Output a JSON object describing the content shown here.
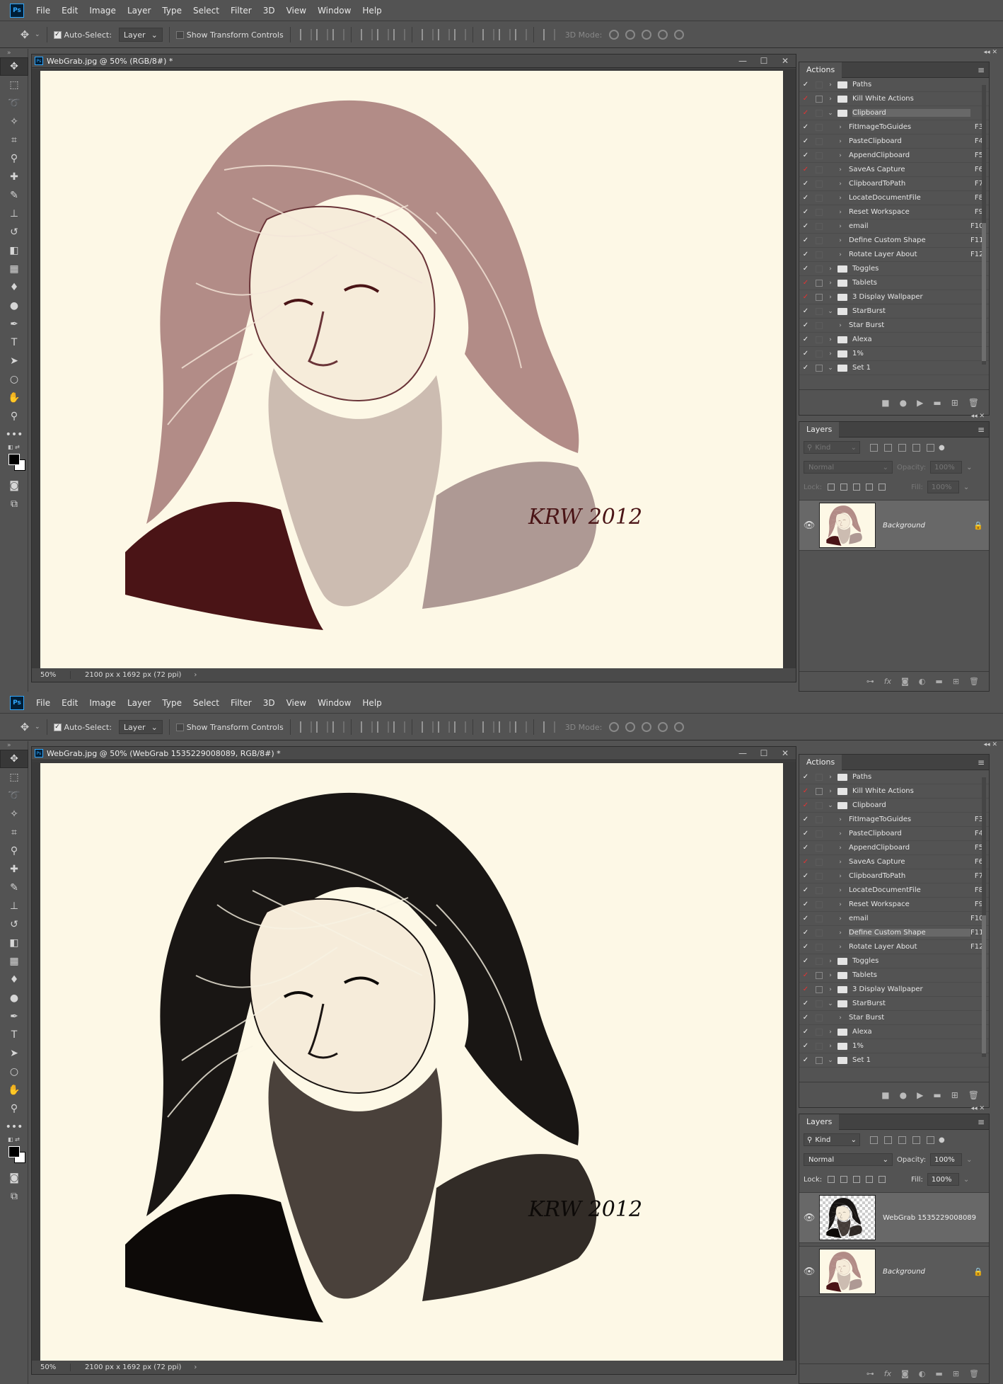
{
  "app": {
    "logo": "Ps"
  },
  "menu": [
    "File",
    "Edit",
    "Image",
    "Layer",
    "Type",
    "Select",
    "Filter",
    "3D",
    "View",
    "Window",
    "Help"
  ],
  "options": {
    "auto_select": "Auto-Select:",
    "auto_select_target": "Layer",
    "show_transform": "Show Transform Controls",
    "mode_3d": "3D Mode:"
  },
  "panels": {
    "actions_tab": "Actions",
    "layers_tab": "Layers",
    "panel_menu_icon": "hamburger-icon"
  },
  "layers_controls": {
    "kind": "Kind",
    "blend": "Normal",
    "opacity_label": "Opacity:",
    "opacity": "100%",
    "lock_label": "Lock:",
    "fill_label": "Fill:",
    "fill": "100%"
  },
  "colors": {
    "accent": "#31a8ff",
    "check_red": "#e63232",
    "paper": "#fdf8e6",
    "ink_sepia": "#4a1416"
  },
  "windows": [
    {
      "doc_title": "WebGrab.jpg @ 50% (RGB/8#) *",
      "zoom": "50%",
      "dims": "2100 px x 1692 px (72 ppi)",
      "signature": "KRW 2012",
      "highlight_action": "Clipboard",
      "layers_enabled": false,
      "actions": [
        {
          "check": "white",
          "dlg": "",
          "twirl": "›",
          "type": "folder",
          "label": "Paths",
          "fkey": ""
        },
        {
          "check": "red",
          "dlg": "box",
          "twirl": "›",
          "type": "folder",
          "label": "Kill White Actions",
          "fkey": ""
        },
        {
          "check": "red",
          "dlg": "",
          "twirl": "⌄",
          "type": "folder",
          "label": "Clipboard",
          "fkey": ""
        },
        {
          "check": "white",
          "dlg": "",
          "twirl": "›",
          "type": "action",
          "label": "FitImageToGuides",
          "fkey": "F3"
        },
        {
          "check": "white",
          "dlg": "",
          "twirl": "›",
          "type": "action",
          "label": "PasteClipboard",
          "fkey": "F4"
        },
        {
          "check": "white",
          "dlg": "",
          "twirl": "›",
          "type": "action",
          "label": "AppendClipboard",
          "fkey": "F5"
        },
        {
          "check": "red",
          "dlg": "",
          "twirl": "›",
          "type": "action",
          "label": "SaveAs Capture",
          "fkey": "F6"
        },
        {
          "check": "white",
          "dlg": "",
          "twirl": "›",
          "type": "action",
          "label": "ClipboardToPath",
          "fkey": "F7"
        },
        {
          "check": "white",
          "dlg": "",
          "twirl": "›",
          "type": "action",
          "label": "LocateDocumentFile",
          "fkey": "F8"
        },
        {
          "check": "white",
          "dlg": "",
          "twirl": "›",
          "type": "action",
          "label": "Reset Workspace",
          "fkey": "F9"
        },
        {
          "check": "white",
          "dlg": "",
          "twirl": "›",
          "type": "action",
          "label": "email",
          "fkey": "F10"
        },
        {
          "check": "white",
          "dlg": "",
          "twirl": "›",
          "type": "action",
          "label": "Define Custom Shape",
          "fkey": "F11"
        },
        {
          "check": "white",
          "dlg": "",
          "twirl": "›",
          "type": "action",
          "label": "Rotate Layer About",
          "fkey": "F12"
        },
        {
          "check": "white",
          "dlg": "",
          "twirl": "›",
          "type": "folder",
          "label": "Toggles",
          "fkey": ""
        },
        {
          "check": "red",
          "dlg": "box",
          "twirl": "›",
          "type": "folder",
          "label": "Tablets",
          "fkey": ""
        },
        {
          "check": "red",
          "dlg": "box",
          "twirl": "›",
          "type": "folder",
          "label": "3 Display Wallpaper",
          "fkey": ""
        },
        {
          "check": "white",
          "dlg": "",
          "twirl": "⌄",
          "type": "folder",
          "label": "StarBurst",
          "fkey": ""
        },
        {
          "check": "white",
          "dlg": "",
          "twirl": "›",
          "type": "action",
          "label": "Star Burst",
          "fkey": ""
        },
        {
          "check": "white",
          "dlg": "",
          "twirl": "›",
          "type": "folder",
          "label": "Alexa",
          "fkey": ""
        },
        {
          "check": "white",
          "dlg": "",
          "twirl": "›",
          "type": "folder",
          "label": "1%",
          "fkey": ""
        },
        {
          "check": "white",
          "dlg": "box",
          "twirl": "⌄",
          "type": "folder",
          "label": "Set 1",
          "fkey": ""
        }
      ],
      "layers": [
        {
          "name": "Background",
          "style": "bg",
          "locked": true,
          "selected": true
        }
      ]
    },
    {
      "doc_title": "WebGrab.jpg @ 50% (WebGrab 1535229008089, RGB/8#) *",
      "zoom": "50%",
      "dims": "2100 px x 1692 px (72 ppi)",
      "signature": "KRW 2012",
      "highlight_action": "Define Custom Shape",
      "layers_enabled": true,
      "actions": [
        {
          "check": "white",
          "dlg": "",
          "twirl": "›",
          "type": "folder",
          "label": "Paths",
          "fkey": ""
        },
        {
          "check": "red",
          "dlg": "box",
          "twirl": "›",
          "type": "folder",
          "label": "Kill White Actions",
          "fkey": ""
        },
        {
          "check": "red",
          "dlg": "",
          "twirl": "⌄",
          "type": "folder",
          "label": "Clipboard",
          "fkey": ""
        },
        {
          "check": "white",
          "dlg": "",
          "twirl": "›",
          "type": "action",
          "label": "FitImageToGuides",
          "fkey": "F3"
        },
        {
          "check": "white",
          "dlg": "",
          "twirl": "›",
          "type": "action",
          "label": "PasteClipboard",
          "fkey": "F4"
        },
        {
          "check": "white",
          "dlg": "",
          "twirl": "›",
          "type": "action",
          "label": "AppendClipboard",
          "fkey": "F5"
        },
        {
          "check": "red",
          "dlg": "",
          "twirl": "›",
          "type": "action",
          "label": "SaveAs Capture",
          "fkey": "F6"
        },
        {
          "check": "white",
          "dlg": "",
          "twirl": "›",
          "type": "action",
          "label": "ClipboardToPath",
          "fkey": "F7"
        },
        {
          "check": "white",
          "dlg": "",
          "twirl": "›",
          "type": "action",
          "label": "LocateDocumentFile",
          "fkey": "F8"
        },
        {
          "check": "white",
          "dlg": "",
          "twirl": "›",
          "type": "action",
          "label": "Reset Workspace",
          "fkey": "F9"
        },
        {
          "check": "white",
          "dlg": "",
          "twirl": "›",
          "type": "action",
          "label": "email",
          "fkey": "F10"
        },
        {
          "check": "white",
          "dlg": "",
          "twirl": "›",
          "type": "action",
          "label": "Define Custom Shape",
          "fkey": "F11"
        },
        {
          "check": "white",
          "dlg": "",
          "twirl": "›",
          "type": "action",
          "label": "Rotate Layer About",
          "fkey": "F12"
        },
        {
          "check": "white",
          "dlg": "",
          "twirl": "›",
          "type": "folder",
          "label": "Toggles",
          "fkey": ""
        },
        {
          "check": "red",
          "dlg": "box",
          "twirl": "›",
          "type": "folder",
          "label": "Tablets",
          "fkey": ""
        },
        {
          "check": "red",
          "dlg": "box",
          "twirl": "›",
          "type": "folder",
          "label": "3 Display Wallpaper",
          "fkey": ""
        },
        {
          "check": "white",
          "dlg": "",
          "twirl": "⌄",
          "type": "folder",
          "label": "StarBurst",
          "fkey": ""
        },
        {
          "check": "white",
          "dlg": "",
          "twirl": "›",
          "type": "action",
          "label": "Star Burst",
          "fkey": ""
        },
        {
          "check": "white",
          "dlg": "",
          "twirl": "›",
          "type": "folder",
          "label": "Alexa",
          "fkey": ""
        },
        {
          "check": "white",
          "dlg": "",
          "twirl": "›",
          "type": "folder",
          "label": "1%",
          "fkey": ""
        },
        {
          "check": "white",
          "dlg": "box",
          "twirl": "⌄",
          "type": "folder",
          "label": "Set 1",
          "fkey": ""
        }
      ],
      "layers": [
        {
          "name": "WebGrab 1535229008089",
          "style": "ink",
          "locked": false,
          "selected": true
        },
        {
          "name": "Background",
          "style": "bg",
          "locked": true,
          "selected": false
        }
      ]
    }
  ]
}
